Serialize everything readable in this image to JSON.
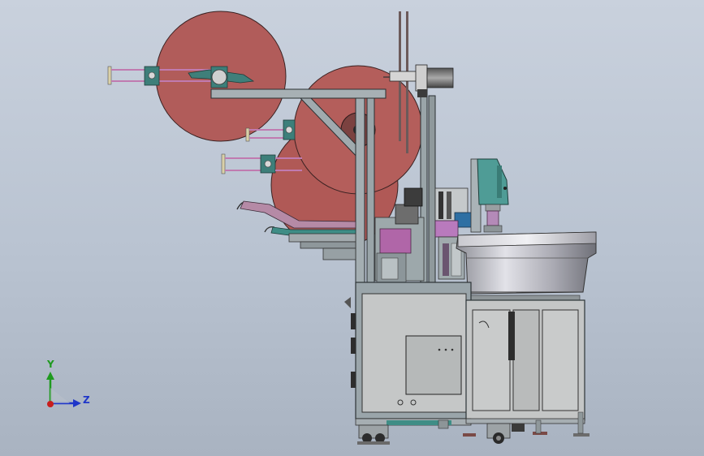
{
  "view": {
    "background_top": "#c9d1dd",
    "background_bottom": "#a9b3c1"
  },
  "triad": {
    "y_label": "Y",
    "z_label": "Z",
    "y_color": "#1f9a1f",
    "z_color": "#1f36c9",
    "origin_color": "#c81e1e"
  },
  "model": {
    "reel_color": "#b15c5a",
    "frame_color": "#9aa6ab",
    "panel_color": "#c7c9c9",
    "bowl_color": "#b8b8c0",
    "accent_teal": "#4f9c96",
    "accent_magenta": "#b06aa8"
  }
}
